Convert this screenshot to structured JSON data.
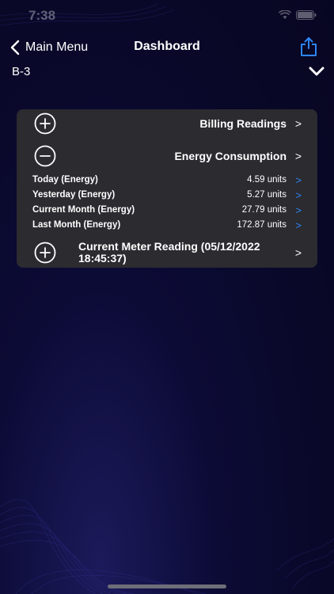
{
  "status_bar": {
    "time": "7:38"
  },
  "nav": {
    "back_label": "Main Menu",
    "title": "Dashboard"
  },
  "site": {
    "label": "B-3"
  },
  "sections": {
    "billing": {
      "label": "Billing Readings",
      "arrow": ">"
    },
    "energy": {
      "label": "Energy Consumption",
      "arrow": ">",
      "readings": [
        {
          "label": "Today (Energy)",
          "value": "4.59 units",
          "arrow": ">"
        },
        {
          "label": "Yesterday (Energy)",
          "value": "5.27 units",
          "arrow": ">"
        },
        {
          "label": "Current Month (Energy)",
          "value": "27.79 units",
          "arrow": ">"
        },
        {
          "label": "Last Month (Energy)",
          "value": "172.87 units",
          "arrow": ">"
        }
      ]
    },
    "meter": {
      "label": "Current Meter Reading (05/12/2022 18:45:37)",
      "arrow": ">"
    }
  },
  "colors": {
    "background": "#090828",
    "card": "#2b2b30",
    "accent_blue": "#2e86f5",
    "text": "#ffffff"
  },
  "icons": {
    "back": "chevron-left-icon",
    "share": "share-icon",
    "dropdown": "chevron-down-icon",
    "expand": "plus-circle-icon",
    "collapse": "minus-circle-icon"
  }
}
